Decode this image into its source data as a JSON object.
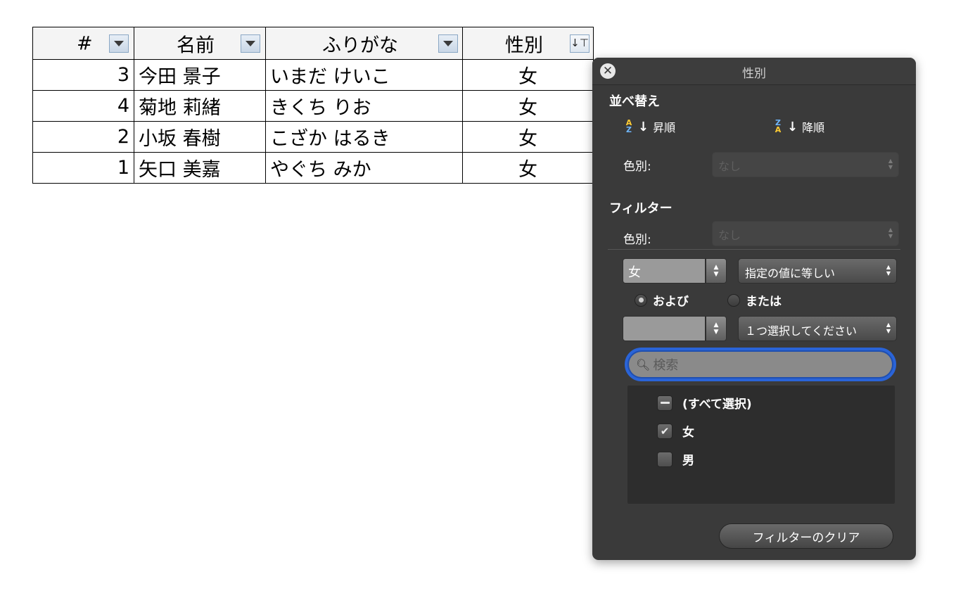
{
  "table": {
    "headers": {
      "num": "#",
      "name": "名前",
      "kana": "ふりがな",
      "sex": "性別"
    },
    "rows": [
      {
        "num": "3",
        "name": "今田 景子",
        "kana": "いまだ けいこ",
        "sex": "女"
      },
      {
        "num": "4",
        "name": "菊地 莉緒",
        "kana": "きくち りお",
        "sex": "女"
      },
      {
        "num": "2",
        "name": "小坂 春樹",
        "kana": "こざか はるき",
        "sex": "女"
      },
      {
        "num": "1",
        "name": "矢口 美嘉",
        "kana": "やぐち みか",
        "sex": "女"
      }
    ]
  },
  "popover": {
    "title": "性別",
    "sort": {
      "heading": "並べ替え",
      "ascending": "昇順",
      "descending": "降順",
      "color_label": "色別:",
      "color_value": "なし"
    },
    "filter": {
      "heading": "フィルター",
      "color_label": "色別:",
      "color_value": "なし",
      "value1": "女",
      "operator1": "指定の値に等しい",
      "radio_and": "および",
      "radio_or": "または",
      "value2": "",
      "operator2": "１つ選択してください",
      "search_placeholder": "検索",
      "items": [
        {
          "label": "(すべて選択)",
          "state": "mixed"
        },
        {
          "label": "女",
          "state": "checked"
        },
        {
          "label": "男",
          "state": "unchecked"
        }
      ],
      "clear_button": "フィルターのクリア"
    }
  }
}
